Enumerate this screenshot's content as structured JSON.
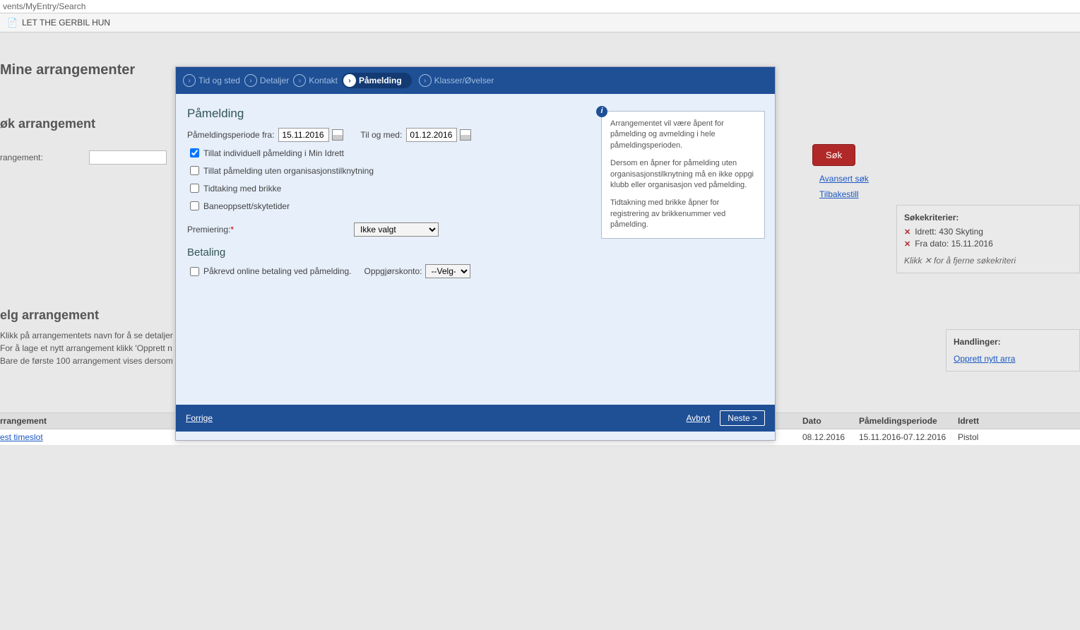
{
  "url": "vents/MyEntry/Search",
  "pageIconGlyph": "📄",
  "pageTitle": "LET THE GERBIL HUN",
  "bg": {
    "h1": "Mine arrangementer",
    "h2": "øk arrangement",
    "arrLabel": "rangement:",
    "searchBtn": "Søk",
    "advSearch": "Avansert søk",
    "reset": "Tilbakestill",
    "criteriaTitle": "Søkekriterier:",
    "crit1": "Idrett: 430 Skyting",
    "crit2": "Fra dato: 15.11.2016",
    "criteriaNote": "Klikk ✕ for å fjerne søkekriteri",
    "actionsTitle": "Handlinger:",
    "actionLink": "Opprett nytt arra",
    "selectH": "elg arrangement",
    "info1": "Klikk på arrangementets navn for å se detaljer",
    "info2": "For å lage et nytt arrangement klikk 'Opprett n",
    "info3": "Bare de første 100 arrangement vises dersom",
    "table": {
      "hArr": "rrangement",
      "hDato": "Dato",
      "hPer": "Påmeldingsperiode",
      "hIdr": "Idrett",
      "row": {
        "arr": "est timeslot",
        "dato": "08.12.2016",
        "per": "15.11.2016-07.12.2016",
        "idr": "Pistol"
      }
    }
  },
  "wizard": {
    "steps": [
      "Tid og sted",
      "Detaljer",
      "Kontakt",
      "Påmelding",
      "Klasser/Øvelser"
    ],
    "activeIndex": 3
  },
  "modal": {
    "h1": "Påmelding",
    "periodLabel": "Påmeldingsperiode fra:",
    "periodFrom": "15.11.2016",
    "periodToLabel": "Til og med:",
    "periodTo": "01.12.2016",
    "chk1": "Tillat individuell påmelding i Min Idrett",
    "chk2": "Tillat påmelding uten organisasjonstilknytning",
    "chk3": "Tidtaking med brikke",
    "chk4": "Baneoppsett/skytetider",
    "premieringLabel": "Premiering:",
    "premieringSelected": "Ikke valgt",
    "h2": "Betaling",
    "chkPay": "Påkrevd online betaling ved påmelding.",
    "oppLabel": "Oppgjørskonto:",
    "oppSelected": "--Velg--",
    "infoP1": "Arrangementet vil være åpent for påmelding og avmelding i hele påmeldingsperioden.",
    "infoP2": "Dersom en åpner for påmelding uten organisasjonstilknytning må en ikke oppgi klubb eller organisasjon ved påmelding.",
    "infoP3": "Tidtakning med brikke åpner for registrering av brikkenummer ved påmelding.",
    "prev": "Forrige",
    "cancel": "Avbryt",
    "next": "Neste >"
  }
}
